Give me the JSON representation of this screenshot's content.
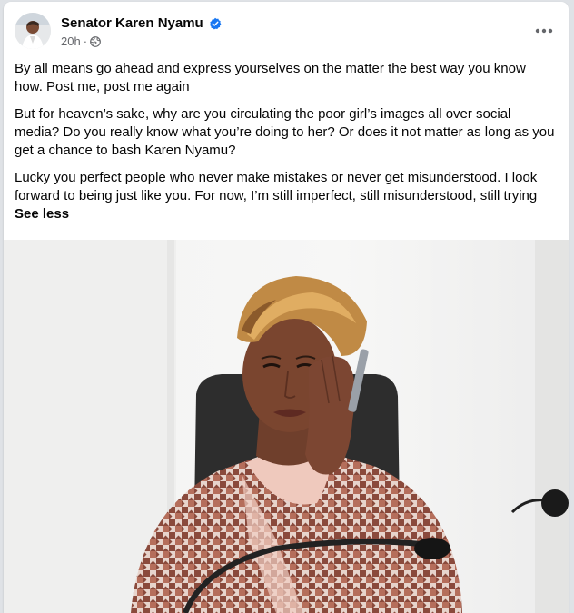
{
  "post": {
    "author": "Senator Karen Nyamu",
    "verified": true,
    "time": "20h",
    "audience_icon": "globe-icon",
    "more_icon": "more-options-icon",
    "paragraphs": [
      "By all means go ahead and express yourselves on the matter the best way you know how. Post me, post me again",
      "But for heaven’s sake, why are you circulating the poor girl’s images all over social media? Do you really know what you’re doing to her? Or does it not matter as long as you get a chance to bash Karen Nyamu?",
      "Lucky you perfect people who never make mistakes or never get misunderstood. I look forward to being just like you. For now, I’m still imperfect, still misunderstood, still trying"
    ],
    "see_less": "See less"
  },
  "colors": {
    "verified_blue": "#1877f2",
    "secondary_text": "#65676b",
    "primary_text": "#050505",
    "houndstooth_brown": "#8a4a3c"
  }
}
